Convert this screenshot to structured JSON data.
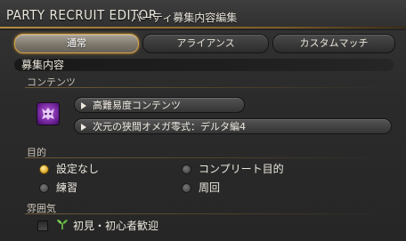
{
  "window": {
    "title_en": "PARTY RECRUIT EDITOR",
    "title_jp": "パーティ募集内容編集"
  },
  "tabs": [
    {
      "label": "通常",
      "active": true
    },
    {
      "label": "アライアンス",
      "active": false
    },
    {
      "label": "カスタムマッチ",
      "active": false
    }
  ],
  "recruit": {
    "header": "募集内容",
    "content_label": "コンテンツ",
    "duty_icon": "alexander-raid-icon",
    "category": "高難易度コンテンツ",
    "duty": "次元の狭間オメガ零式：デルタ編4"
  },
  "objective": {
    "label": "目的",
    "options": [
      {
        "label": "設定なし",
        "selected": true
      },
      {
        "label": "コンプリート目的",
        "selected": false
      },
      {
        "label": "練習",
        "selected": false
      },
      {
        "label": "周回",
        "selected": false
      }
    ]
  },
  "atmosphere": {
    "label": "雰囲気",
    "checkbox_label": "初見・初心者歓迎",
    "checked": false,
    "icon": "sprout-icon"
  },
  "colors": {
    "accent_gold": "#d7a445",
    "radio_on": "#e2b233",
    "duty_icon_purple": "#8a2fb8"
  }
}
